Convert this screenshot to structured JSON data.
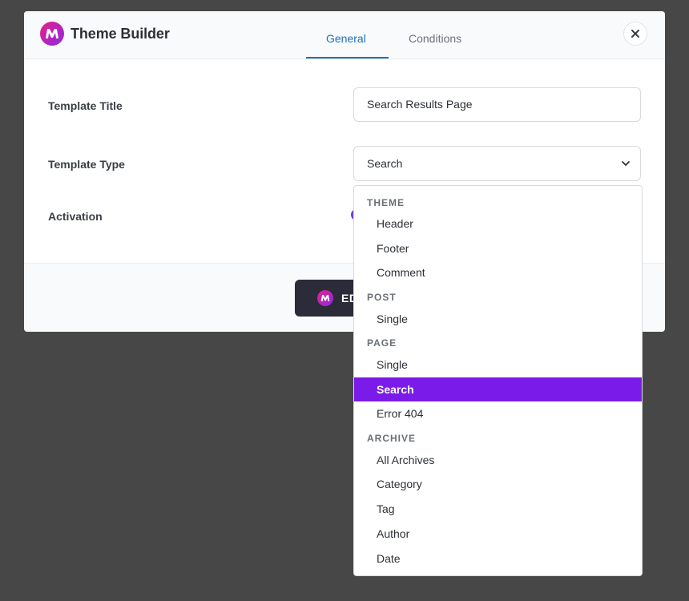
{
  "header": {
    "title": "Theme Builder",
    "tabs": [
      {
        "label": "General",
        "active": true
      },
      {
        "label": "Conditions",
        "active": false
      }
    ],
    "close_icon": "close-icon",
    "accent_color": "#1f6fb8"
  },
  "form": {
    "template_title": {
      "label": "Template Title",
      "value": "Search Results Page"
    },
    "template_type": {
      "label": "Template Type",
      "value": "Search",
      "chevron_icon": "chevron-down-icon"
    },
    "activation": {
      "label": "Activation"
    }
  },
  "footer": {
    "edit_label": "ED"
  },
  "dropdown": {
    "selected_color": "#7b1be9",
    "groups": [
      {
        "label": "THEME",
        "items": [
          "Header",
          "Footer",
          "Comment"
        ]
      },
      {
        "label": "POST",
        "items": [
          "Single"
        ]
      },
      {
        "label": "PAGE",
        "items": [
          "Single",
          "Search",
          "Error 404"
        ]
      },
      {
        "label": "ARCHIVE",
        "items": [
          "All Archives",
          "Category",
          "Tag",
          "Author",
          "Date"
        ]
      }
    ],
    "selected": "Search"
  }
}
